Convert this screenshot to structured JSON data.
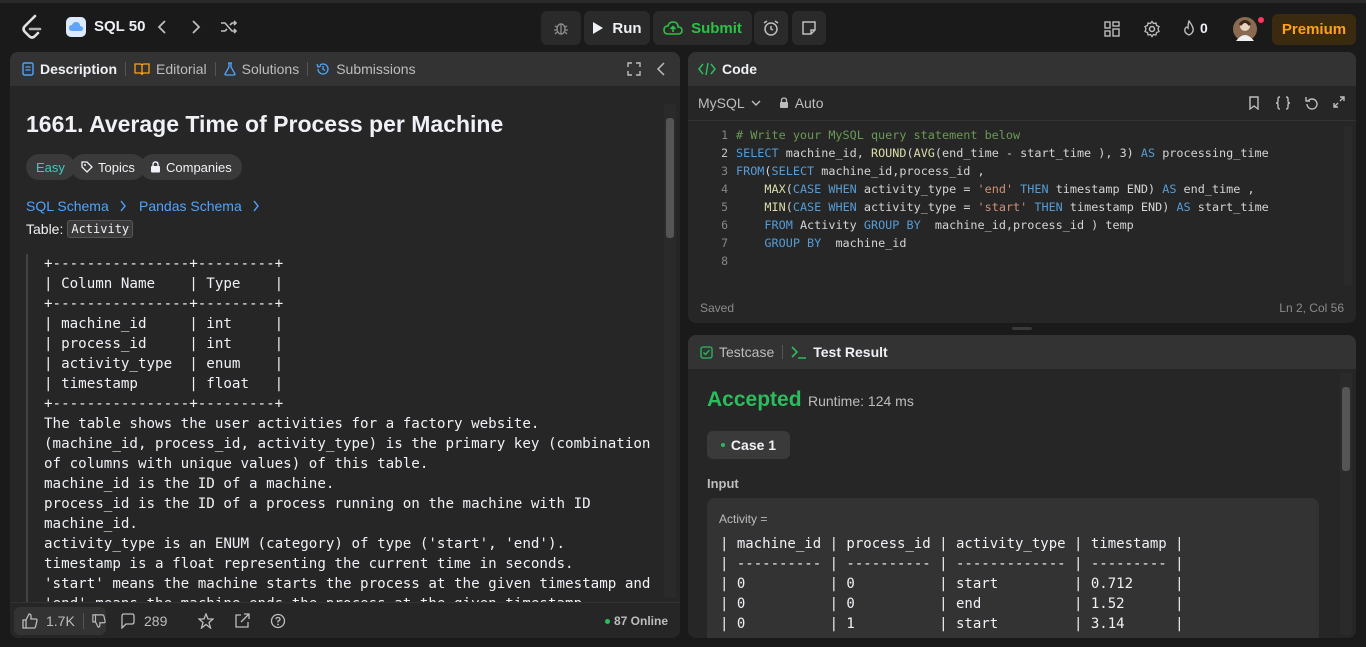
{
  "topbar": {
    "list_title": "SQL 50",
    "run_label": "Run",
    "submit_label": "Submit",
    "streak_count": "0",
    "premium_label": "Premium"
  },
  "description_panel": {
    "tabs": [
      {
        "label": "Description",
        "icon": "description-icon"
      },
      {
        "label": "Editorial",
        "icon": "book-icon"
      },
      {
        "label": "Solutions",
        "icon": "flask-icon"
      },
      {
        "label": "Submissions",
        "icon": "history-icon"
      }
    ],
    "title": "1661. Average Time of Process per Machine",
    "difficulty": "Easy",
    "topics_label": "Topics",
    "companies_label": "Companies",
    "schema_links": [
      "SQL Schema",
      "Pandas Schema"
    ],
    "table_prefix": "Table:",
    "table_name": "Activity",
    "body_lines": [
      "+----------------+---------+",
      "| Column Name    | Type    |",
      "+----------------+---------+",
      "| machine_id     | int     |",
      "| process_id     | int     |",
      "| activity_type  | enum    |",
      "| timestamp      | float   |",
      "+----------------+---------+",
      "The table shows the user activities for a factory website.",
      "(machine_id, process_id, activity_type) is the primary key (combination",
      "of columns with unique values) of this table.",
      "machine_id is the ID of a machine.",
      "process_id is the ID of a process running on the machine with ID",
      "machine_id.",
      "activity_type is an ENUM (category) of type ('start', 'end').",
      "timestamp is a float representing the current time in seconds.",
      "'start' means the machine starts the process at the given timestamp and",
      "'end' means the machine ends the process at the given timestamp."
    ],
    "footer": {
      "likes": "1.7K",
      "comments": "289",
      "online": "87 Online"
    }
  },
  "code_panel": {
    "title": "Code",
    "language": "MySQL",
    "mode": "Auto",
    "line_numbers": [
      "1",
      "2",
      "3",
      "4",
      "5",
      "6",
      "7",
      "8"
    ],
    "status": "Saved",
    "cursor": "Ln 2, Col 56"
  },
  "result_panel": {
    "tabs": [
      "Testcase",
      "Test Result"
    ],
    "verdict": "Accepted",
    "runtime": "Runtime: 124 ms",
    "case_label": "Case 1",
    "input_label": "Input",
    "input_name": "Activity =",
    "result_lines": [
      "| machine_id | process_id | activity_type | timestamp |",
      "| ---------- | ---------- | ------------- | --------- |",
      "| 0          | 0          | start         | 0.712     |",
      "| 0          | 0          | end           | 1.52      |",
      "| 0          | 1          | start         | 3.14      |"
    ]
  },
  "colors": {
    "accepted": "#2cbb5d",
    "easy": "#46c6c2",
    "link": "#4ea4ff",
    "premium": "#ffa116"
  }
}
